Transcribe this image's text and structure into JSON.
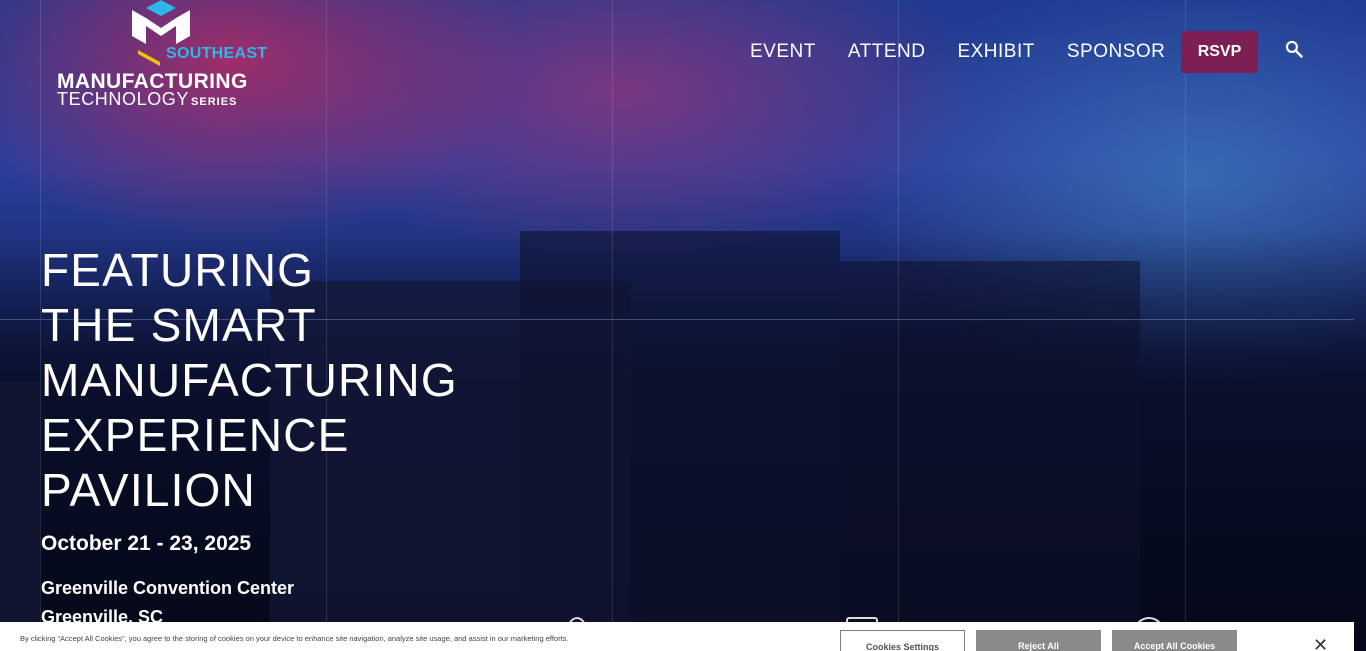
{
  "header": {
    "logo": {
      "subtitle": "SOUTHEAST",
      "line1": "MANUFACTURING",
      "line2": "TECHNOLOGY",
      "series": "SERIES"
    },
    "nav": [
      {
        "label": "EVENT"
      },
      {
        "label": "ATTEND"
      },
      {
        "label": "EXHIBIT"
      },
      {
        "label": "SPONSOR"
      }
    ],
    "rsvp_label": "RSVP",
    "search_icon": "search-icon"
  },
  "hero": {
    "headline_lines": [
      "FEATURING",
      "THE SMART",
      "MANUFACTURING",
      "EXPERIENCE",
      "PAVILION"
    ],
    "date": "October 21 - 23, 2025",
    "venue": "Greenville Convention Center",
    "city": "Greenville, SC"
  },
  "cookie_banner": {
    "text": "By clicking “Accept All Cookies”, you agree to the storing of cookies on your device to enhance site navigation, analyze site usage, and assist in our marketing efforts.",
    "settings_label": "Cookies Settings",
    "reject_label": "Reject All",
    "accept_label": "Accept All Cookies",
    "close_label": "✕"
  },
  "colors": {
    "rsvp_bg": "#7b1f55",
    "logo_accent": "#2fb6e9",
    "logo_yellow": "#f4c20d"
  }
}
